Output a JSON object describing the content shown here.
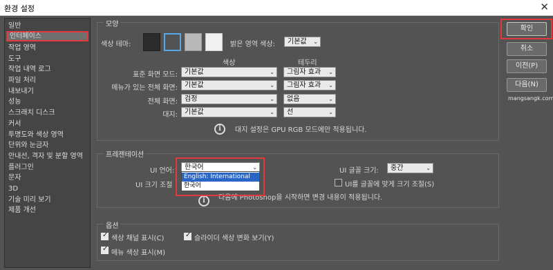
{
  "window": {
    "title": "환경 설정",
    "close_glyph": "✕"
  },
  "sidebar": {
    "items": [
      {
        "label": "일반"
      },
      {
        "label": "인터페이스",
        "selected": true
      },
      {
        "label": "작업 영역"
      },
      {
        "label": "도구"
      },
      {
        "label": "작업 내역 로그"
      },
      {
        "label": "파일 처리"
      },
      {
        "label": "내보내기"
      },
      {
        "label": "성능"
      },
      {
        "label": "스크래치 디스크"
      },
      {
        "label": "커서"
      },
      {
        "label": "투명도와 색상 영역"
      },
      {
        "label": "단위와 눈금자"
      },
      {
        "label": "안내선, 격자 및 분할 영역"
      },
      {
        "label": "플러그인"
      },
      {
        "label": "문자"
      },
      {
        "label": "3D"
      },
      {
        "label": "기술 미리 보기"
      },
      {
        "label": "제품 개선"
      }
    ]
  },
  "appearance": {
    "section_title": "모양",
    "color_theme_label": "색상 테마:",
    "swatch_colors": [
      "#2b2b2b",
      "#535353",
      "#b8b8b8",
      "#f0f0f0"
    ],
    "selected_swatch": 1,
    "highlight_color_label": "밝은 영역 색상:",
    "highlight_color_value": "기본값",
    "column_color": "색상",
    "column_border": "테두리",
    "rows": [
      {
        "label": "표준 화면 모드:",
        "color": "기본값",
        "border": "그림자 효과"
      },
      {
        "label": "메뉴가 있는 전체 화면:",
        "color": "기본값",
        "border": "그림자 효과"
      },
      {
        "label": "전체 화면:",
        "color": "검정",
        "border": "없음"
      },
      {
        "label": "대지:",
        "color": "기본값",
        "border": "선"
      }
    ],
    "info_text": "대지 설정은 GPU RGB 모드에만 적용됩니다."
  },
  "presentation": {
    "section_title": "프레젠테이션",
    "ui_language_label": "UI 언어:",
    "ui_language_value": "한국어",
    "ui_language_options": [
      "English: International",
      "한국어"
    ],
    "ui_font_size_label": "UI 글꼴 크기:",
    "ui_font_size_value": "중간",
    "ui_scale_label": "UI 크기 조절",
    "scale_to_font_label": "UI를 글꼴에 맞게 크기 조절(S)",
    "scale_to_font_checked": false,
    "info_text": "다음에 Photoshop을 시작하면 변경 내용이 적용됩니다."
  },
  "options": {
    "section_title": "옵션",
    "show_channels_in_color": {
      "label": "색상 채널 표시(C)",
      "checked": true
    },
    "dynamic_color_sliders": {
      "label": "슬라이더 색상 변화 보기(Y)",
      "checked": true
    },
    "show_menu_colors": {
      "label": "메뉴 색상 표시(M)",
      "checked": true
    }
  },
  "buttons": {
    "ok": "확인",
    "cancel": "취소",
    "prev": "이전(P)",
    "next": "다음(N)"
  },
  "watermark": "mangsangk.com",
  "icons": {
    "info": "i",
    "chevron": "⌄"
  },
  "accent": {
    "highlight_red": "#e2383f",
    "selection_blue": "#2a66c6"
  }
}
